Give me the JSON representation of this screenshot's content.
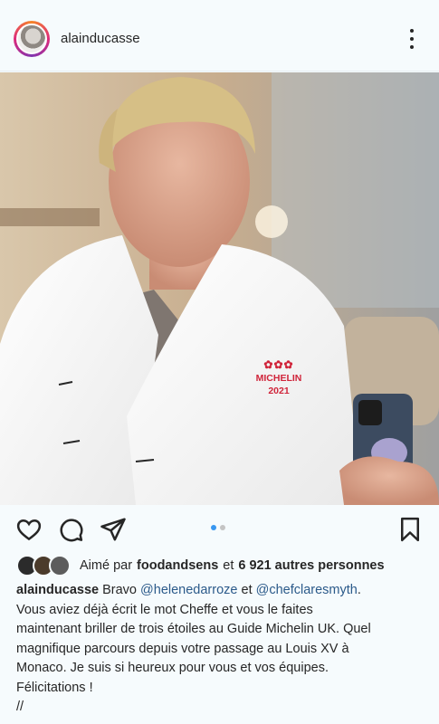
{
  "post": {
    "username": "alainducasse"
  },
  "photo": {
    "jacket_text": {
      "stars": "✿✿✿",
      "brand": "MICHELIN",
      "year": "2021"
    }
  },
  "carousel": {
    "count": 2,
    "active_index": 0
  },
  "likes": {
    "prefix": "Aimé par",
    "user": "foodandsens",
    "connector": "et",
    "others": "6 921 autres personnes"
  },
  "caption": {
    "username": "alainducasse",
    "text_start": "Bravo",
    "mention1": "@helenedarroze",
    "and": "et",
    "mention2": "@chefclaresmyth",
    "period": ".",
    "line2": "Vous aviez déjà écrit le mot Cheffe et vous le faites",
    "line3": "maintenant briller de trois étoiles au Guide Michelin UK. Quel",
    "line4": "magnifique parcours depuis votre passage au Louis XV à",
    "line5": "Monaco. Je suis si heureux pour vous et vos équipes.",
    "line6": "Félicitations !",
    "line7": "//"
  },
  "icons": {
    "like": "heart-icon",
    "comment": "comment-icon",
    "share": "send-icon",
    "save": "bookmark-icon",
    "more": "more-vertical-icon"
  },
  "colors": {
    "background": "#f6fbfd",
    "text": "#262626",
    "mention": "#2b5a8a",
    "carousel_active": "#3897f0",
    "michelin_red": "#d0243a"
  }
}
